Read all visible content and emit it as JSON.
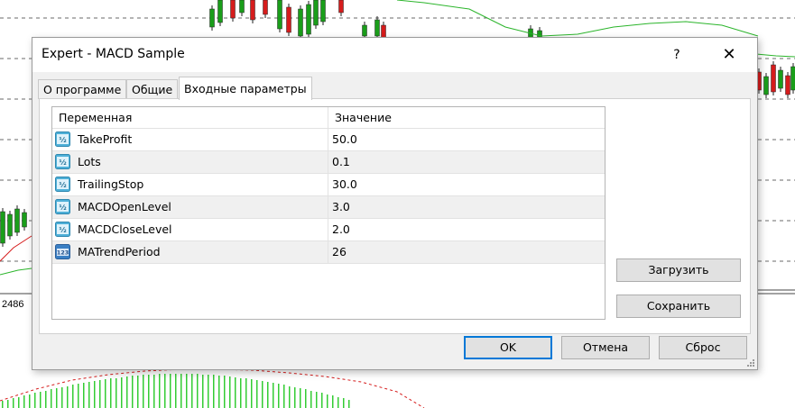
{
  "background": {
    "price_label": "2486",
    "colors": {
      "bull": "#1a9e1a",
      "bear": "#d61c1c",
      "ma": "#2bb52b",
      "grid": "#6a6a6a",
      "histogram": "#33cc33"
    }
  },
  "dialog": {
    "title": "Expert - MACD Sample",
    "help_label": "?",
    "close_label": "✕",
    "tabs": [
      {
        "label": "О программе"
      },
      {
        "label": "Общие"
      },
      {
        "label": "Входные параметры",
        "active": true
      }
    ],
    "table": {
      "col_variable": "Переменная",
      "col_value": "Значение",
      "rows": [
        {
          "name": "TakeProfit",
          "value": "50.0",
          "icon": "double-value-icon"
        },
        {
          "name": "Lots",
          "value": "0.1",
          "icon": "double-value-icon"
        },
        {
          "name": "TrailingStop",
          "value": "30.0",
          "icon": "double-value-icon"
        },
        {
          "name": "MACDOpenLevel",
          "value": "3.0",
          "icon": "double-value-icon"
        },
        {
          "name": "MACDCloseLevel",
          "value": "2.0",
          "icon": "double-value-icon"
        },
        {
          "name": "MATrendPeriod",
          "value": "26",
          "icon": "integer-value-icon"
        }
      ]
    },
    "buttons": {
      "load": "Загрузить",
      "save": "Сохранить",
      "ok": "OK",
      "cancel": "Отмена",
      "reset": "Сброс"
    }
  }
}
